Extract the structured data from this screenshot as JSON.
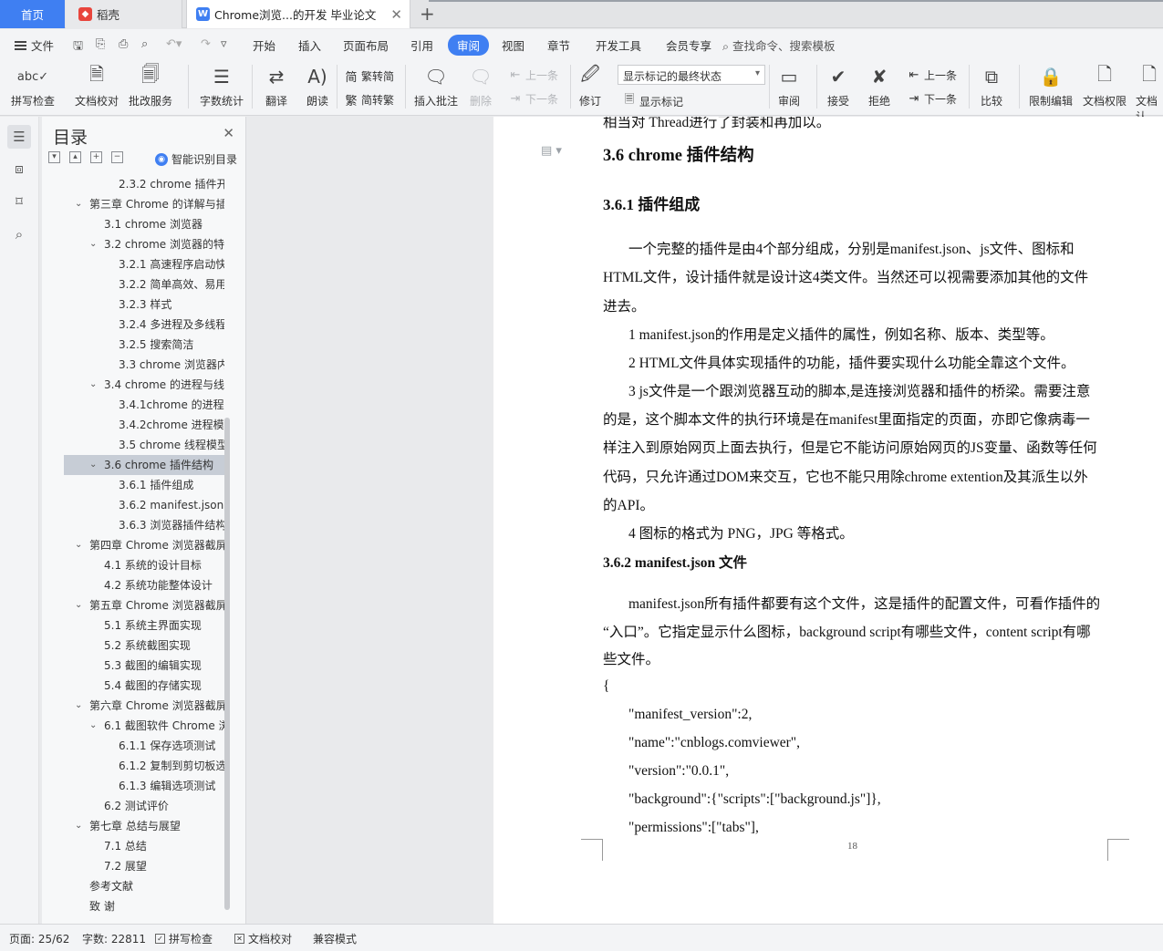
{
  "tabs": {
    "home": "首页",
    "daoke": "稻壳",
    "doc": "Chrome浏览...的开发 毕业论文",
    "doc_icon": "W"
  },
  "menu": {
    "file": "文件",
    "items": [
      "开始",
      "插入",
      "页面布局",
      "引用",
      "审阅",
      "视图",
      "章节",
      "开发工具",
      "会员专享"
    ],
    "active": "审阅",
    "search": "查找命令、搜索模板"
  },
  "ribbon": {
    "spell_check": "拼写检查",
    "doc_proof": "文档校对",
    "annot_service": "批改服务",
    "word_count": "字数统计",
    "translate": "翻译",
    "read_aloud": "朗读",
    "trad_to_simp": "繁转简",
    "simp_to_trad": "简转繁",
    "insert_comment": "插入批注",
    "delete": "删除",
    "prev_comment": "上一条",
    "next_comment": "下一条",
    "revise": "修订",
    "markup_state": "显示标记的最终状态",
    "show_markup": "显示标记",
    "review": "审阅",
    "accept": "接受",
    "reject": "拒绝",
    "prev_change": "上一条",
    "next_change": "下一条",
    "compare": "比较",
    "restrict_edit": "限制编辑",
    "doc_permission": "文档权限",
    "doc_cut": "文档认"
  },
  "toc": {
    "title": "目录",
    "smart": "智能识别目录",
    "items": [
      {
        "label": "2.3.2 chrome 插件开...",
        "level": 3,
        "arrow": ""
      },
      {
        "label": "第三章  Chrome 的详解与插...",
        "level": 1,
        "arrow": "v"
      },
      {
        "label": "3.1 chrome 浏览器",
        "level": 2,
        "arrow": ""
      },
      {
        "label": "3.2 chrome 浏览器的特...",
        "level": 2,
        "arrow": "v"
      },
      {
        "label": "3.2.1 高速程序启动快...",
        "level": 3,
        "arrow": ""
      },
      {
        "label": "3.2.2 简单高效、易用...",
        "level": 3,
        "arrow": ""
      },
      {
        "label": "3.2.3 样式",
        "level": 3,
        "arrow": ""
      },
      {
        "label": "3.2.4 多进程及多线程...",
        "level": 3,
        "arrow": ""
      },
      {
        "label": "3.2.5 搜索简洁",
        "level": 3,
        "arrow": ""
      },
      {
        "label": "3.3 chrome 浏览器内...",
        "level": 3,
        "arrow": ""
      },
      {
        "label": "3.4 chrome 的进程与线...",
        "level": 2,
        "arrow": "v"
      },
      {
        "label": "3.4.1chrome 的进程...",
        "level": 3,
        "arrow": ""
      },
      {
        "label": "3.4.2chrome 进程模...",
        "level": 3,
        "arrow": ""
      },
      {
        "label": "3.5 chrome 线程模型",
        "level": 3,
        "arrow": ""
      },
      {
        "label": "3.6 chrome 插件结构",
        "level": 2,
        "arrow": "v",
        "selected": true
      },
      {
        "label": "3.6.1 插件组成",
        "level": 3,
        "arrow": ""
      },
      {
        "label": "3.6.2 manifest.json ...",
        "level": 3,
        "arrow": ""
      },
      {
        "label": "3.6.3 浏览器插件结构",
        "level": 3,
        "arrow": ""
      },
      {
        "label": "第四章  Chrome 浏览器截屏...",
        "level": 1,
        "arrow": "v"
      },
      {
        "label": "4.1 系统的设计目标",
        "level": 2,
        "arrow": ""
      },
      {
        "label": "4.2 系统功能整体设计",
        "level": 2,
        "arrow": ""
      },
      {
        "label": "第五章  Chrome 浏览器截屏...",
        "level": 1,
        "arrow": "v"
      },
      {
        "label": "5.1 系统主界面实现",
        "level": 2,
        "arrow": ""
      },
      {
        "label": "5.2 系统截图实现",
        "level": 2,
        "arrow": ""
      },
      {
        "label": "5.3 截图的编辑实现",
        "level": 2,
        "arrow": ""
      },
      {
        "label": "5.4 截图的存储实现",
        "level": 2,
        "arrow": ""
      },
      {
        "label": "第六章  Chrome 浏览器截屏...",
        "level": 1,
        "arrow": "v"
      },
      {
        "label": "6.1 截图软件 Chrome 浏...",
        "level": 2,
        "arrow": "v"
      },
      {
        "label": "6.1.1 保存选项测试",
        "level": 3,
        "arrow": ""
      },
      {
        "label": "6.1.2 复制到剪切板选...",
        "level": 3,
        "arrow": ""
      },
      {
        "label": "6.1.3 编辑选项测试",
        "level": 3,
        "arrow": ""
      },
      {
        "label": "6.2 测试评价",
        "level": 2,
        "arrow": ""
      },
      {
        "label": "第七章  总结与展望",
        "level": 1,
        "arrow": "v"
      },
      {
        "label": "7.1 总结",
        "level": 2,
        "arrow": ""
      },
      {
        "label": "7.2 展望",
        "level": 2,
        "arrow": ""
      },
      {
        "label": "参考文献",
        "level": 1,
        "arrow": ""
      },
      {
        "label": "致    谢",
        "level": 1,
        "arrow": ""
      }
    ]
  },
  "doc": {
    "cut_top": "相当对 Thread进行了封装和再加以。",
    "h36": "3.6 chrome 插件结构",
    "h361": "3.6.1 插件组成",
    "p1_l1": "一个完整的插件是由4个部分组成，分别是manifest.json、js文件、图标和",
    "p1_l2": "HTML文件，设计插件就是设计这4类文件。当然还可以视需要添加其他的文件",
    "p1_l3": "进去。",
    "item1": "1 manifest.json的作用是定义插件的属性，例如名称、版本、类型等。",
    "item2": "2 HTML文件具体实现插件的功能，插件要实现什么功能全靠这个文件。",
    "item3_l1": "3 js文件是一个跟浏览器互动的脚本,是连接浏览器和插件的桥梁。需要注意",
    "item3_l2": "的是，这个脚本文件的执行环境是在manifest里面指定的页面，亦即它像病毒一",
    "item3_l3": "样注入到原始网页上面去执行，但是它不能访问原始网页的JS变量、函数等任何",
    "item3_l4": "代码，只允许通过DOM来交互，它也不能只用除chrome extention及其派生以外",
    "item3_l5": "的API。",
    "item4": "4  图标的格式为 PNG，JPG 等格式。",
    "h362": "3.6.2 manifest.json 文件",
    "p2_l1": "manifest.json所有插件都要有这个文件，这是插件的配置文件，可看作插件的",
    "p2_l2": "“入口”。它指定显示什么图标，background script有哪些文件，content script有哪",
    "p2_l3": "些文件。",
    "code_open": "{",
    "code1": "\"manifest_version\":2,",
    "code2": "\"name\":\"cnblogs.comviewer\",",
    "code3": "\"version\":\"0.0.1\",",
    "code4": "\"background\":{\"scripts\":[\"background.js\"]},",
    "code5": "\"permissions\":[\"tabs\"],",
    "page_number": "18"
  },
  "status": {
    "page": "页面: 25/62",
    "words": "字数: 22811",
    "spell": "拼写检查",
    "proof": "文档校对",
    "compat": "兼容模式"
  },
  "colors": {
    "accent": "#3f7ff2"
  }
}
